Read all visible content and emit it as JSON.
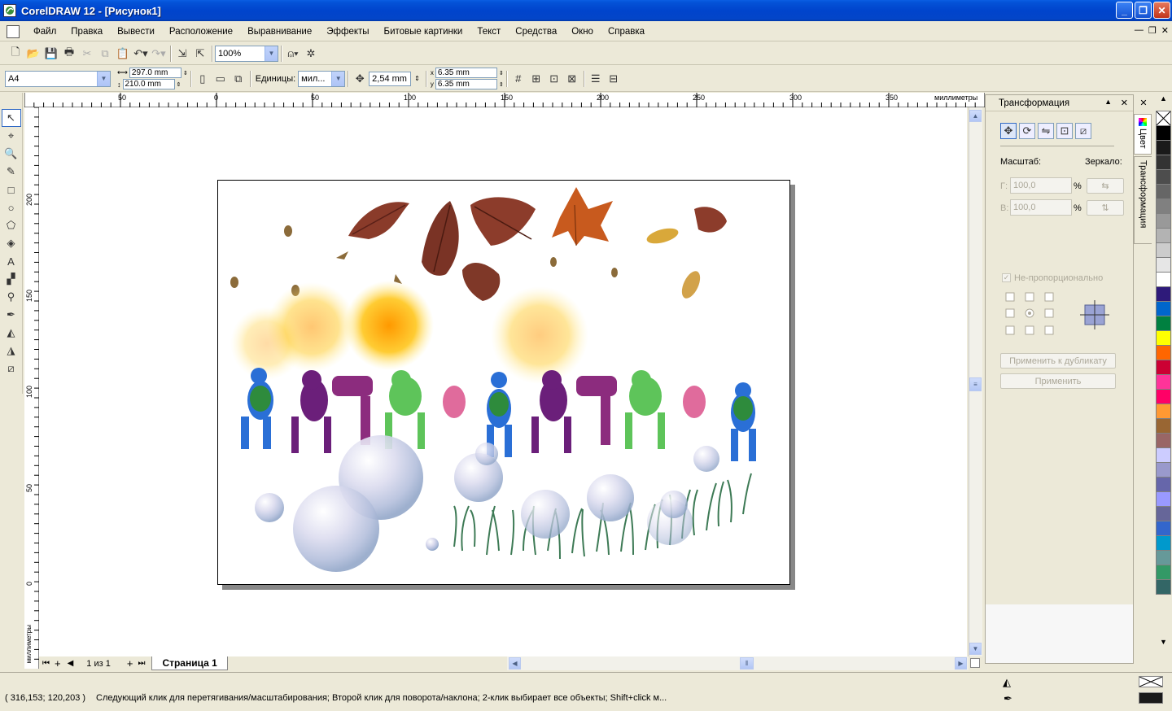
{
  "window": {
    "title": "CorelDRAW 12 - [Рисунок1]"
  },
  "menu": [
    "Файл",
    "Правка",
    "Вывести",
    "Расположение",
    "Выравнивание",
    "Эффекты",
    "Битовые картинки",
    "Текст",
    "Средства",
    "Окно",
    "Справка"
  ],
  "toolbar": {
    "zoom": "100%"
  },
  "property_bar": {
    "paper": "A4",
    "width": "297.0 mm",
    "height": "210.0 mm",
    "units_label": "Единицы:",
    "units": "мил...",
    "nudge": "2,54 mm",
    "dup_x": "6.35 mm",
    "dup_y": "6.35 mm"
  },
  "ruler": {
    "h_labels": [
      "50",
      "0",
      "50",
      "100",
      "150",
      "200",
      "250",
      "300",
      "350"
    ],
    "h_units": "миллиметры",
    "v_labels": [
      "200",
      "150",
      "100",
      "50",
      "0"
    ],
    "v_units": "миллиметры"
  },
  "pages": {
    "count": "1 из 1",
    "tab": "Страница 1"
  },
  "status": {
    "coords": "( 316,153; 120,203 )",
    "message": "Следующий клик для перетягивания/масштабирования; Второй клик для поворота/наклона; 2-клик выбирает все объекты; Shift+click м..."
  },
  "docker": {
    "title": "Трансформация",
    "scale_label": "Масштаб:",
    "mirror_label": "Зеркало:",
    "h_label": "Г:",
    "v_label": "В:",
    "h_value": "100,0",
    "v_value": "100,0",
    "percent": "%",
    "nonprop": "Не-пропорционально",
    "apply_dup": "Применить к дубликату",
    "apply": "Применить"
  },
  "side_tabs": [
    "Цвет",
    "Трансформация"
  ],
  "palette": [
    "#ffffff",
    "#000000",
    "#1a1a1a",
    "#333333",
    "#4d4d4d",
    "#666666",
    "#808080",
    "#999999",
    "#b3b3b3",
    "#cccccc",
    "#e6e6e6",
    "#ffffff",
    "#2e1a7a",
    "#0066cc",
    "#008040",
    "#ffff00",
    "#ff6600",
    "#cc0033",
    "#ff3399",
    "#ff0066",
    "#ff9933",
    "#996633",
    "#996666",
    "#ccccff",
    "#9999cc",
    "#6666aa",
    "#9999ff",
    "#666699",
    "#3366cc",
    "#0099cc",
    "#669999",
    "#339966",
    "#336666",
    "#003333",
    "#ffffff"
  ]
}
